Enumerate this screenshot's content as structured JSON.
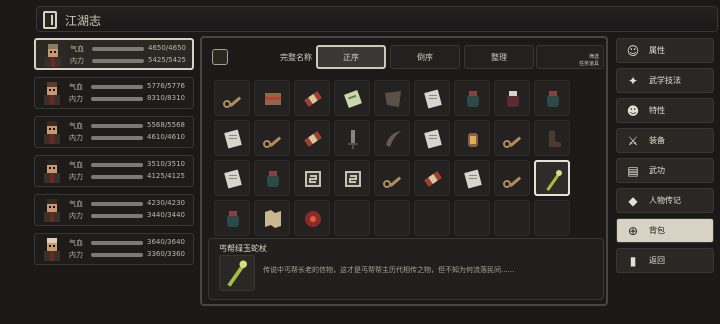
{
  "window": {
    "title": "江湖志"
  },
  "characters": [
    {
      "hp_label": "气血",
      "hp": "4650/4650",
      "mp_label": "内力",
      "mp": "5425/5425",
      "active": true
    },
    {
      "hp_label": "气血",
      "hp": "5776/5776",
      "mp_label": "内力",
      "mp": "8310/8310",
      "active": false
    },
    {
      "hp_label": "气血",
      "hp": "5568/5568",
      "mp_label": "内力",
      "mp": "4610/4610",
      "active": false
    },
    {
      "hp_label": "气血",
      "hp": "3510/3510",
      "mp_label": "内力",
      "mp": "4125/4125",
      "active": false
    },
    {
      "hp_label": "气血",
      "hp": "4230/4230",
      "mp_label": "内力",
      "mp": "3440/3440",
      "active": false
    },
    {
      "hp_label": "气血",
      "hp": "3640/3640",
      "mp_label": "内力",
      "mp": "3360/3360",
      "active": false
    }
  ],
  "toolbar": {
    "full_name": "完整名称",
    "asc": "正序",
    "desc": "倒序",
    "sort": "整理",
    "filter_line1": "筛选",
    "filter_line2": "任务道具"
  },
  "inventory": {
    "items": [
      "key-icon",
      "bundle-icon",
      "scroll-icon",
      "manual-icon",
      "cloth-icon",
      "paper-icon",
      "jar-icon",
      "pot-icon",
      "jar-icon",
      "paper-icon",
      "key-icon",
      "scroll-icon",
      "dagger-icon",
      "horn-icon",
      "paper-icon",
      "lantern-icon",
      "key-icon",
      "boot-icon",
      "paper-icon",
      "jar-icon",
      "talisman-icon",
      "talisman-icon",
      "key-icon",
      "scroll-icon",
      "paper-icon",
      "key-icon",
      "staff-icon",
      "jar-icon",
      "map-icon",
      "flower-icon",
      "",
      "",
      "",
      "",
      "",
      ""
    ],
    "selected_index": 26
  },
  "detail": {
    "name": "丐帮绿玉蛇杖",
    "icon": "staff-icon",
    "description": "传说中丐帮长老的信物，这才是丐帮帮主历代相传之物，但不知为何流落民间......"
  },
  "menu": [
    {
      "label": "属性",
      "icon": "attributes-icon",
      "glyph": "☺"
    },
    {
      "label": "武学技法",
      "icon": "martial-arts-icon",
      "glyph": "✦"
    },
    {
      "label": "特性",
      "icon": "traits-icon",
      "glyph": "☻"
    },
    {
      "label": "装备",
      "icon": "equipment-icon",
      "glyph": "⚔"
    },
    {
      "label": "武功",
      "icon": "kungfu-book-icon",
      "glyph": "▤"
    },
    {
      "label": "人物传记",
      "icon": "biography-icon",
      "glyph": "◆"
    },
    {
      "label": "背包",
      "icon": "bag-icon",
      "glyph": "⊕",
      "active": true
    },
    {
      "label": "返回",
      "icon": "back-icon",
      "glyph": "▮"
    }
  ],
  "colors": {
    "accent": "#d8d2c4",
    "panel": "#1c1a18",
    "bar": "#7d7a74"
  }
}
